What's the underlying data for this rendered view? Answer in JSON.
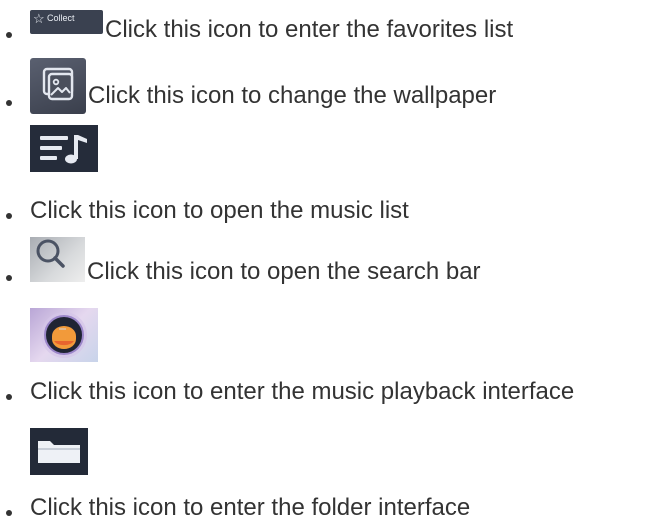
{
  "items": [
    {
      "icon": "star-collect-icon",
      "icon_label": "Collect",
      "text": "Click this icon to enter the favorites list"
    },
    {
      "icon": "wallpaper-icon",
      "text": "Click this icon to change the wallpaper"
    },
    {
      "icon": "music-list-icon",
      "text": "Click this icon to open the music list"
    },
    {
      "icon": "search-icon",
      "text": "Click this icon to open the search bar"
    },
    {
      "icon": "music-player-icon",
      "text": "Click this icon to enter the music playback interface"
    },
    {
      "icon": "folder-icon",
      "text": "Click this icon to enter the folder interface"
    }
  ],
  "colors": {
    "text": "#333333",
    "icon_dark_bg": "#252c3a",
    "icon_light": "#e9edf3"
  }
}
